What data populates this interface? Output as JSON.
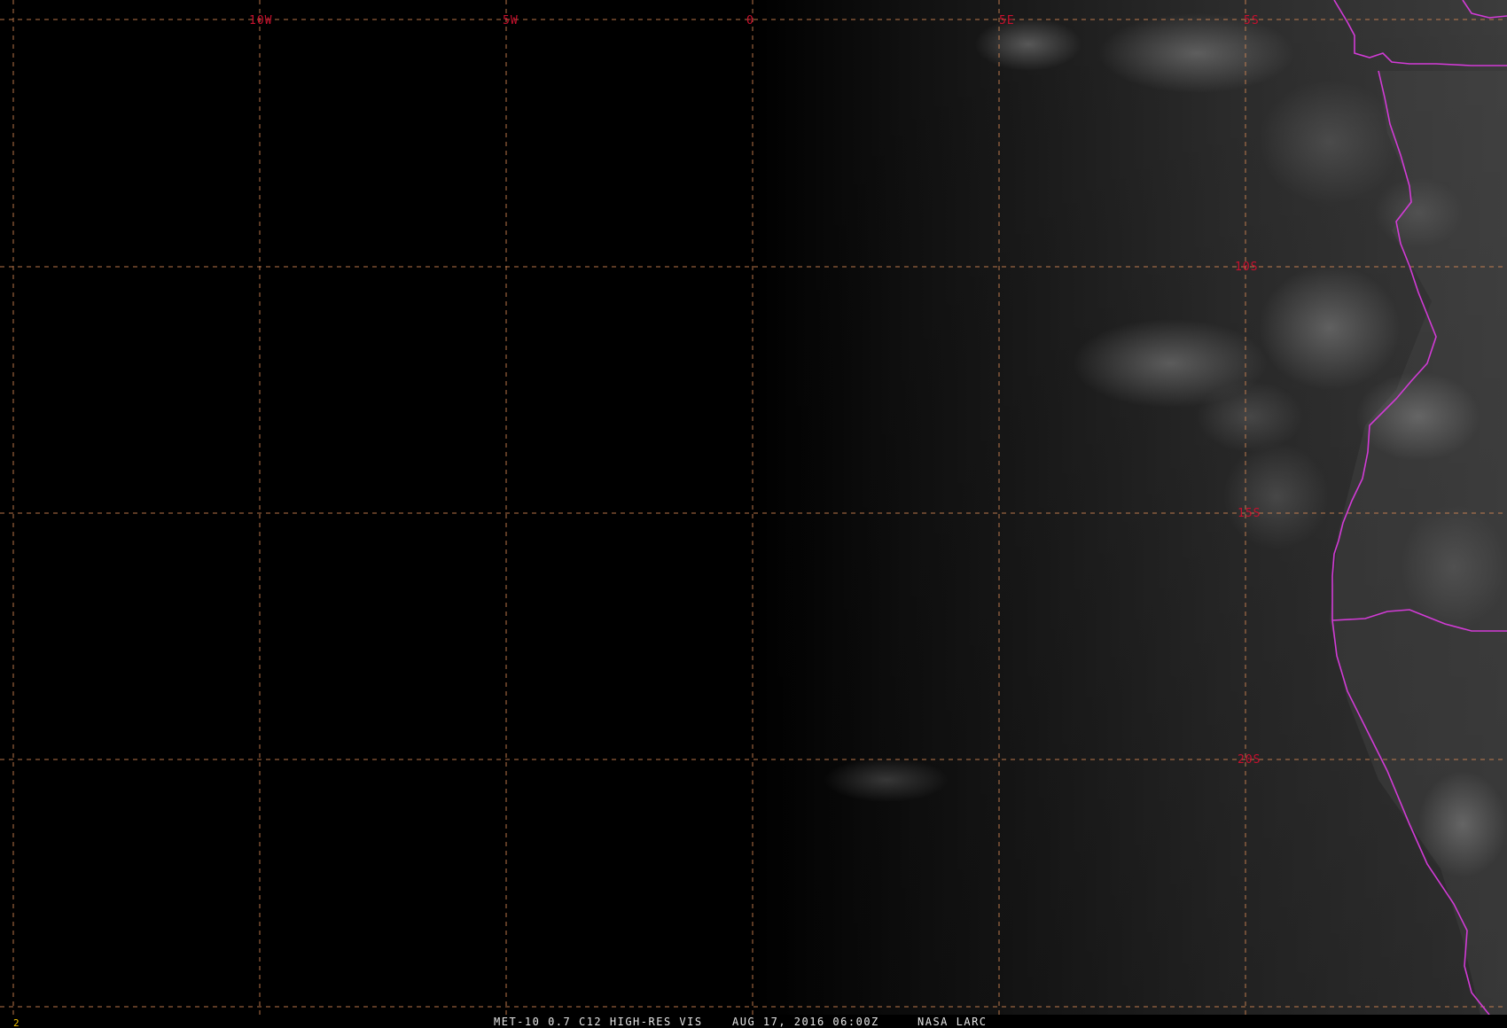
{
  "colors": {
    "background": "#000000",
    "grid_line": "#d98a55",
    "grid_label": "#c8102e",
    "coastline": "#d23bd6",
    "status_text": "#e6e6e6",
    "frame_number": "#f2c200"
  },
  "map": {
    "longitude_labels": [
      "10W",
      "5W",
      "0",
      "5E",
      "5S"
    ],
    "latitude_labels": [
      "10S",
      "15S",
      "20S"
    ],
    "grid_style": "dashed",
    "overlay": "political-boundaries"
  },
  "status_bar": {
    "frame_number": "2",
    "product": "MET-10 0.7 C12 HIGH-RES VIS",
    "datetime": "AUG 17, 2016 06:00Z",
    "source": "NASA LARC"
  }
}
